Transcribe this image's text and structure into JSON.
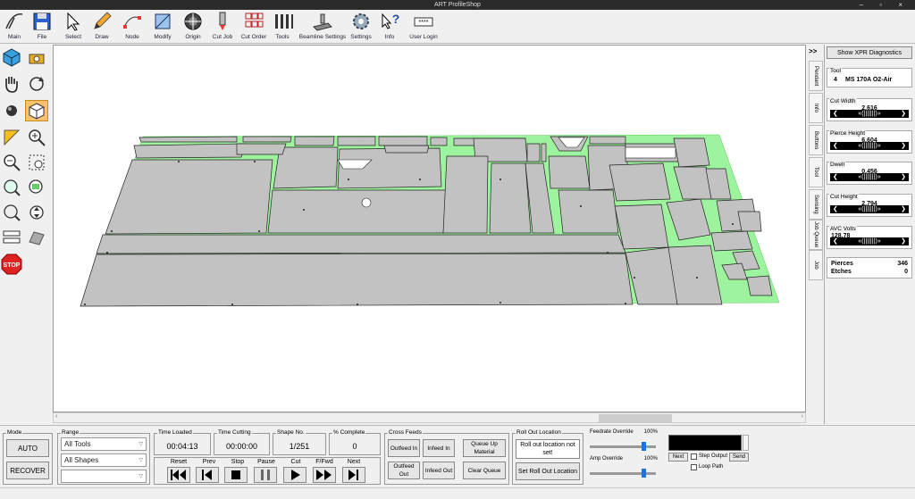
{
  "window": {
    "title": "ART ProfileShop",
    "controls": "– ▫ ×"
  },
  "toolbar": {
    "items": [
      {
        "label": "Main",
        "icon": "main-icon"
      },
      {
        "label": "File",
        "icon": "floppy-icon"
      },
      {
        "label": "Select",
        "icon": "cursor-icon"
      },
      {
        "label": "Draw",
        "icon": "pencil-icon"
      },
      {
        "label": "Node",
        "icon": "node-icon"
      },
      {
        "label": "Modify",
        "icon": "modify-icon"
      },
      {
        "label": "Origin",
        "icon": "origin-icon"
      },
      {
        "label": "Cut Job",
        "icon": "torch-icon"
      },
      {
        "label": "Cut Order",
        "icon": "cut-order-icon"
      },
      {
        "label": "Tools",
        "icon": "tools-icon"
      },
      {
        "label": "Beamline Settings",
        "icon": "beamline-icon"
      },
      {
        "label": "Settings",
        "icon": "gear-icon"
      },
      {
        "label": "Info",
        "icon": "help-icon"
      },
      {
        "label": "User Login",
        "icon": "login-icon"
      }
    ]
  },
  "right_panel": {
    "collapse": ">>",
    "diagnostics_button": "Show XPR Diagnostics",
    "tabs": [
      "Pendant",
      "Info",
      "Buttons",
      "Tool",
      "Sensing",
      "Job Queue",
      "Job"
    ],
    "tool": {
      "label": "Tool",
      "number": "4",
      "name": "MS 170A O2-Air"
    },
    "cut_width": {
      "label": "Cut Width",
      "value": "2.616"
    },
    "pierce_height": {
      "label": "Pierce Height",
      "value": "6.604"
    },
    "dwell": {
      "label": "Dwell",
      "value": "0.456"
    },
    "cut_height": {
      "label": "Cut Height",
      "value": "2.794"
    },
    "avc_volts": {
      "label": "AVC Volts",
      "value": "128.78"
    },
    "pierces": {
      "label": "Pierces",
      "value": "346"
    },
    "etches": {
      "label": "Etches",
      "value": "0"
    }
  },
  "bottom": {
    "mode": {
      "label": "Mode",
      "auto": "AUTO",
      "recover": "RECOVER"
    },
    "range": {
      "label": "Range",
      "select1": "All Tools",
      "select2": "All Shapes",
      "select3": ""
    },
    "time_loaded": {
      "label": "Time Loaded",
      "value": "00:04:13"
    },
    "time_cutting": {
      "label": "Time Cutting",
      "value": "00:00:00"
    },
    "shape_no": {
      "label": "Shape No.",
      "value": "1/251"
    },
    "percent_complete": {
      "label": "% Complete",
      "value": "0"
    },
    "playback": [
      "Reset",
      "Prev",
      "Stop",
      "Pause",
      "Cut",
      "F/Fwd",
      "Next"
    ],
    "cross_feeds": {
      "label": "Cross Feeds",
      "outfeed_in": "Outfeed In",
      "infeed_in": "Infeed In",
      "queue_up": "Queue Up Material",
      "outfeed_out": "Outfeed Out",
      "infeed_out": "Infeed Out",
      "clear_queue": "Clear Queue"
    },
    "roll_out": {
      "label": "Roll Out Location",
      "message": "Roll out location not set!",
      "button": "Set Roll Out Location"
    },
    "feedrate": {
      "label": "Feedrate Override",
      "value": "100%",
      "level": 100
    },
    "amp": {
      "label": "Amp Override",
      "value": "100%",
      "level": 100
    },
    "output": {
      "next": "Next",
      "step_output": "Step Output",
      "send": "Send",
      "loop_path": "Loop Path"
    }
  }
}
